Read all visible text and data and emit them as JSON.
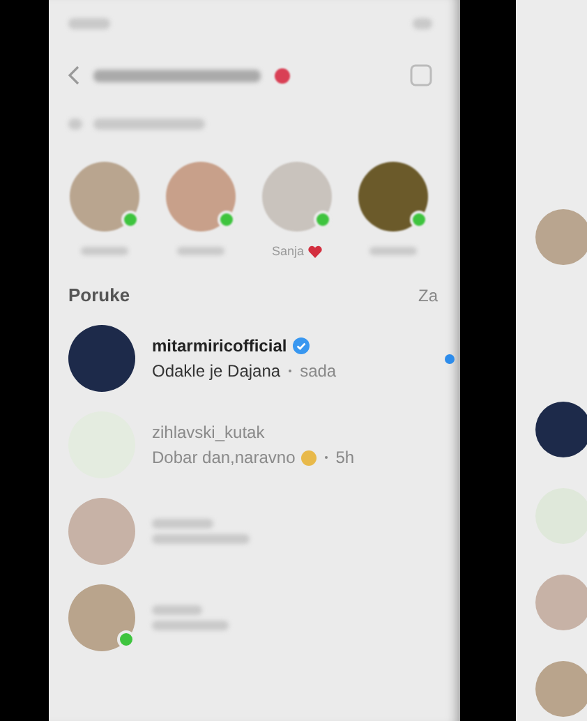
{
  "stories": [
    {
      "online": true,
      "heart": false
    },
    {
      "online": true,
      "heart": false
    },
    {
      "name": "Sanja",
      "online": true,
      "heart": true
    },
    {
      "online": true,
      "heart": false
    }
  ],
  "section": {
    "title": "Poruke",
    "action": "Za"
  },
  "messages": [
    {
      "kind": "readable",
      "username": "mitarmiricofficial",
      "verified": true,
      "preview": "Odakle je Dajana",
      "time": "sada",
      "unread": true,
      "online": false
    },
    {
      "kind": "readable",
      "username": "zihlavski_kutak",
      "verified": false,
      "preview": "Dobar dan,naravno",
      "time": "5h",
      "unread": false,
      "online": false
    },
    {
      "kind": "blurred",
      "unread": false,
      "online": false
    },
    {
      "kind": "blurred",
      "unread": false,
      "online": true
    }
  ]
}
